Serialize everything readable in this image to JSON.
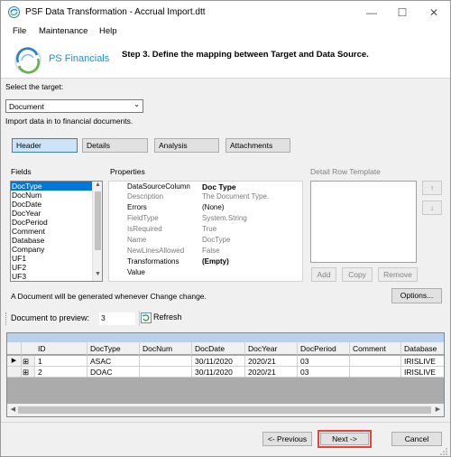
{
  "window": {
    "title": "PSF Data Transformation - Accrual Import.dtt"
  },
  "menu": [
    "File",
    "Maintenance",
    "Help"
  ],
  "banner": {
    "logo_text": "PS Financials",
    "step_text": "Step 3. Define the mapping between Target and Data Source."
  },
  "target": {
    "label": "Select the target:",
    "selected": "Document",
    "description": "Import data in to financial documents."
  },
  "tabs": [
    "Header",
    "Details",
    "Analysis",
    "Attachments"
  ],
  "fields": {
    "label": "Fields",
    "items": [
      "DocType",
      "DocNum",
      "DocDate",
      "DocYear",
      "DocPeriod",
      "Comment",
      "Database",
      "Company",
      "UF1",
      "UF2",
      "UF3"
    ],
    "selected_index": 0
  },
  "properties": {
    "label": "Properties",
    "rows": [
      {
        "name": "DataSourceColumn",
        "value": "Doc Type"
      },
      {
        "name": "Description",
        "value": "The Document Type."
      },
      {
        "name": "Errors",
        "value": "(None)"
      },
      {
        "name": "FieldType",
        "value": "System.String"
      },
      {
        "name": "IsRequired",
        "value": "True"
      },
      {
        "name": "Name",
        "value": "DocType"
      },
      {
        "name": "NewLinesAllowed",
        "value": "False"
      },
      {
        "name": "Transformations",
        "value": "(Empty)"
      },
      {
        "name": "Value",
        "value": ""
      }
    ]
  },
  "detail_template": {
    "label": "Detail Row Template",
    "add_label": "Add",
    "copy_label": "Copy",
    "remove_label": "Remove",
    "up_glyph": "↑",
    "down_glyph": "↓"
  },
  "info_text": "A Document will be generated whenever Change change.",
  "options_label": "Options...",
  "preview": {
    "label": "Document to preview:",
    "value": "3",
    "refresh_label": "Refresh"
  },
  "grid": {
    "columns": [
      "",
      "ID",
      "DocType",
      "DocNum",
      "DocDate",
      "DocYear",
      "DocPeriod",
      "Comment",
      "Database"
    ],
    "rows": [
      {
        "id": "1",
        "doctype": "ASAC",
        "docnum": "",
        "docdate": "30/11/2020",
        "docyear": "2020/21",
        "docperiod": "03",
        "comment": "",
        "database": "IRISLIVE"
      },
      {
        "id": "2",
        "doctype": "DOAC",
        "docnum": "",
        "docdate": "30/11/2020",
        "docyear": "2020/21",
        "docperiod": "03",
        "comment": "",
        "database": "IRISLIVE"
      }
    ]
  },
  "footer": {
    "previous_label": "<- Previous",
    "next_label": "Next ->",
    "cancel_label": "Cancel"
  },
  "colors": {
    "accent": "#1f8fd0",
    "selection": "#0078d7",
    "highlight_box": "#e0443a"
  }
}
